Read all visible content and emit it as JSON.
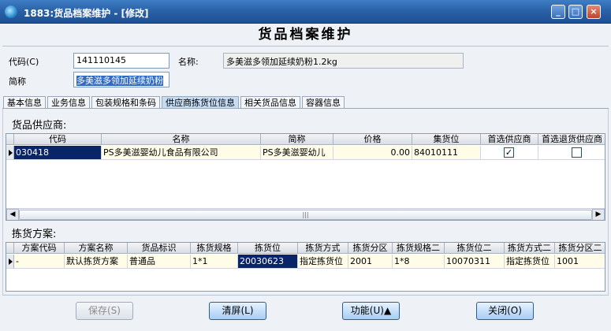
{
  "window": {
    "title": "1883:货品档案维护 - [修改]"
  },
  "heading": "货品档案维护",
  "form": {
    "code_label": "代码(C)",
    "code_value": "141110145",
    "name_label": "名称:",
    "name_value": "多美滋多领加延续奶粉1.2kg",
    "short_label": "简称",
    "short_value": "多美滋多领加延续奶粉"
  },
  "tabs": [
    "基本信息",
    "业务信息",
    "包装规格和条码",
    "供应商拣货位信息",
    "相关货品信息",
    "容器信息"
  ],
  "active_tab": "供应商拣货位信息",
  "suppliers": {
    "title": "货品供应商:",
    "columns": [
      "代码",
      "名称",
      "简称",
      "价格",
      "集货位",
      "首选供应商",
      "首选退货供应商"
    ],
    "rows": [
      {
        "code": "030418",
        "name": "PS多美滋婴幼儿食品有限公司",
        "short": "PS多美滋婴幼儿",
        "price": "0.00",
        "location": "84010111",
        "preferred": true,
        "preferred_return": false
      }
    ]
  },
  "picking": {
    "title": "拣货方案:",
    "columns": [
      "方案代码",
      "方案名称",
      "货品标识",
      "拣货规格",
      "拣货位",
      "拣货方式",
      "拣货分区",
      "拣货规格二",
      "拣货位二",
      "拣货方式二",
      "拣货分区二"
    ],
    "rows": [
      [
        "-",
        "默认拣货方案",
        "普通品",
        "1*1",
        "20030623",
        "指定拣货位",
        "2001",
        "1*8",
        "10070311",
        "指定拣货位",
        "1001"
      ]
    ]
  },
  "buttons": {
    "save": "保存(S)",
    "clear": "清屏(L)",
    "function": "功能(U)▲",
    "close": "关闭(O)"
  },
  "colors": {
    "titlebar": "#2a62a8",
    "button": "#a8cdf3",
    "selection": "#0a246a"
  }
}
